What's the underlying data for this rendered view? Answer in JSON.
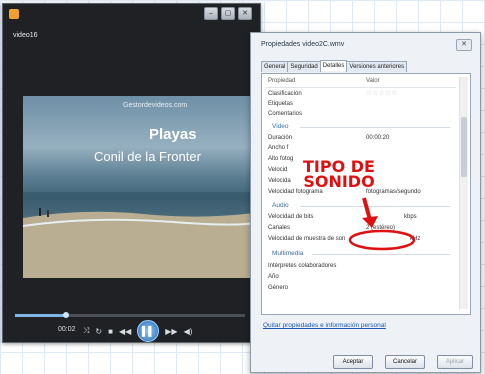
{
  "player": {
    "title": "video16",
    "window_buttons": [
      "–",
      "▢",
      "✕"
    ],
    "video": {
      "site": "Gestordevideos.com",
      "title_line1": "Playas",
      "title_line2": "Conil de la Fronter"
    },
    "time": "00:02",
    "progress": 0.22,
    "controls": {
      "shuffle": "⤨",
      "repeat": "↻",
      "stop": "■",
      "prev": "◀◀",
      "play": "▌▌",
      "next": "▶▶",
      "volume": "◀)"
    }
  },
  "dialog": {
    "title": "Propiedades video2C.wmv",
    "close": "✕",
    "tabs": [
      "General",
      "Seguridad",
      "Detalles",
      "Versiones anteriores"
    ],
    "active_tab": 2,
    "columns": [
      "Propiedad",
      "Valor"
    ],
    "rows_top": [
      {
        "label": "Clasificación",
        "value": "☆☆☆☆☆"
      },
      {
        "label": "Etiquetas",
        "value": ""
      },
      {
        "label": "Comentarios",
        "value": ""
      }
    ],
    "section_video": "Video",
    "rows_video": [
      {
        "label": "Duración",
        "value": "00:00:20"
      },
      {
        "label": "Ancho f",
        "value": ""
      },
      {
        "label": "Alto fotog",
        "value": ""
      },
      {
        "label": "Velocid",
        "value": ""
      },
      {
        "label": "Velocida",
        "value": ""
      },
      {
        "label": "Velocidad fotograma",
        "value": "fotogramas/segundo"
      }
    ],
    "section_audio": "Audio",
    "rows_audio": [
      {
        "label": "Velocidad de bits",
        "value": "kbps"
      },
      {
        "label": "Canales",
        "value": "2 (estéreo)"
      },
      {
        "label": "Velocidad de muestra de son",
        "value": "kHz"
      }
    ],
    "section_media": "Multimedia",
    "rows_media": [
      {
        "label": "Intérpretes colaboradores",
        "value": ""
      },
      {
        "label": "Año",
        "value": ""
      },
      {
        "label": "Género",
        "value": ""
      }
    ],
    "link": "Quitar propiedades e información personal",
    "buttons": {
      "accept": "Aceptar",
      "cancel": "Cancelar",
      "apply": "Aplicar"
    }
  },
  "annotation": {
    "line1": "TIPO DE",
    "line2": "SONIDO",
    "color": "#e01010"
  }
}
